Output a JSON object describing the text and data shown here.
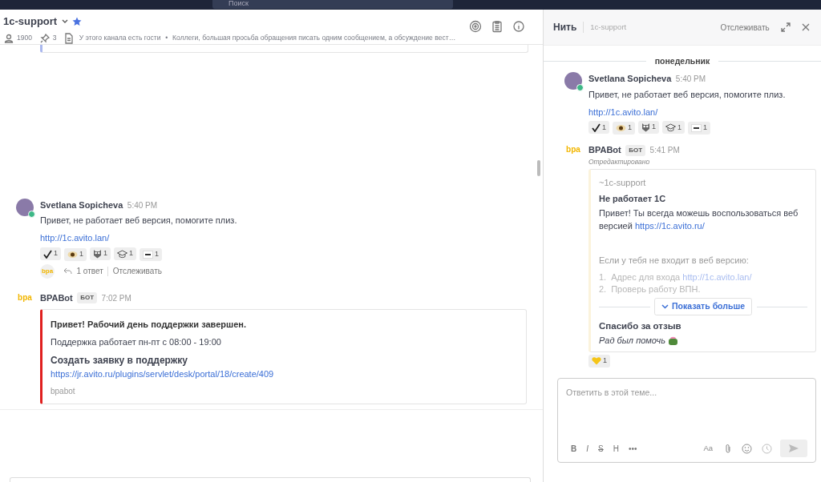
{
  "top_bar": {
    "search": "Поиск"
  },
  "channel": {
    "name": "1c-support",
    "favorite": true,
    "members": "1900",
    "pinned": "3",
    "guests_note": "У этого канала есть гости",
    "separator": "•",
    "topic": "Коллеги, большая просьба обращения писать одним сообщением, а обсуждение вест…"
  },
  "messages": [
    {
      "author": "Svetlana Sopicheva",
      "kind": "user",
      "time": "5:40 PM",
      "text": "Привет, не работает веб версия, помогите плиз.",
      "link": "http://1c.avito.lan/",
      "reactions": [
        {
          "kind": "check",
          "count": "1"
        },
        {
          "kind": "eye",
          "count": "1"
        },
        {
          "kind": "owl",
          "count": "1"
        },
        {
          "kind": "cap",
          "count": "1"
        },
        {
          "kind": "sticker",
          "count": "1"
        }
      ],
      "thread": {
        "avatar_text": "bpa",
        "replies": "1 ответ",
        "follow": "Отслеживать"
      }
    },
    {
      "author": "BPABot",
      "kind": "bot",
      "avatar_text": "bpa",
      "badge": "БОТ",
      "time": "7:02 PM",
      "attachment": {
        "title": "Привет! Рабочий день поддержки завершен.",
        "text": "Поддержка работает пн-пт с 08:00 - 19:00",
        "subtitle": "Создать заявку в поддержку",
        "link": "https://jr.avito.ru/plugins/servlet/desk/portal/18/create/409",
        "footer": "bpabot"
      }
    }
  ],
  "thread": {
    "title": "Нить",
    "channel": "1c-support",
    "follow": "Отслеживать",
    "date": "понедельник",
    "messages": [
      {
        "author": "Svetlana Sopicheva",
        "kind": "user",
        "time": "5:40 PM",
        "text": "Привет, не работает веб версия, помогите плиз.",
        "link": "http://1c.avito.lan/",
        "reactions": [
          {
            "kind": "check",
            "count": "1"
          },
          {
            "kind": "eye",
            "count": "1"
          },
          {
            "kind": "owl",
            "count": "1"
          },
          {
            "kind": "cap",
            "count": "1"
          },
          {
            "kind": "sticker",
            "count": "1"
          }
        ]
      },
      {
        "author": "BPABot",
        "kind": "bot",
        "avatar_text": "bpa",
        "badge": "БОТ",
        "time": "5:41 PM",
        "edited": "Отредактировано",
        "attachment": {
          "pretext": "~1c-support",
          "title": "Не работает 1С",
          "text": "Привет! Ты всегда можешь воспользоваться веб версией",
          "text_link": "https://1c.avito.ru/",
          "intro": "Если у тебя не входит в веб версию:",
          "list": [
            {
              "number": "1.",
              "text": "Адрес для входа",
              "link": "http://1c.avito.lan/"
            },
            {
              "number": "2.",
              "text": "Проверь работу ВПН."
            }
          ],
          "show_more": "Показать больше",
          "thanks_title": "Спасибо за отзыв",
          "thanks_text": "Рад был помочь"
        },
        "reactions": [
          {
            "kind": "heart",
            "count": "1"
          }
        ]
      }
    ],
    "composer": {
      "placeholder": "Ответить в этой теме...",
      "format_buttons": [
        {
          "label": "B",
          "kind": "bold"
        },
        {
          "label": "I",
          "kind": "italic"
        },
        {
          "label": "S",
          "kind": "strike"
        },
        {
          "label": "H",
          "kind": "heading"
        },
        {
          "label": "•••",
          "kind": "more"
        }
      ],
      "font_size": "Aa"
    }
  }
}
